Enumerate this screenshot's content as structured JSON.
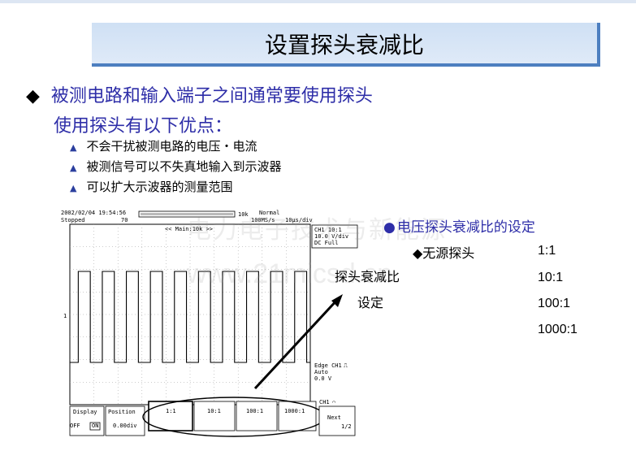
{
  "title": "设置探头衰减比",
  "bullet": {
    "line1": "被测电路和输入端子之间通常要使用探头",
    "line2": "使用探头有以下优点：",
    "subs": [
      "不会干扰被测电路的电压・电流",
      "被测信号可以不失真地输入到示波器",
      "可以扩大示波器的测量范围"
    ]
  },
  "scope": {
    "datetime": "2002/02/04 19:54:56",
    "status": "Stopped",
    "count": "70",
    "mode": "Normal",
    "rate": "100MS/s",
    "timediv": "10μs/div",
    "length": "10k",
    "main_label": "<< Main:10k >>",
    "ch_info": [
      "CH1 10:1",
      "10.0 V/div",
      "DC    Full"
    ],
    "trig_info": [
      "Edge CH1",
      "Auto",
      "0.0 V"
    ],
    "ch_marker": "1",
    "softkeys": {
      "display_label": "Display",
      "display_off": "OFF",
      "display_on": "ON",
      "position_label": "Position",
      "position_value": "0.00div",
      "r1": "1:1",
      "r10": "10:1",
      "r100": "100:1",
      "r1000": "1000:1",
      "ch_label": "CH1",
      "next_label": "Next",
      "next_page": "1/2"
    }
  },
  "right": {
    "heading": "电压探头衰减比的设定",
    "passive": "◆无源探头",
    "ratios": [
      "1:1",
      "10:1",
      "100:1",
      "1000:1"
    ]
  },
  "annotation": {
    "line1": "探头衰减比",
    "line2": "设定"
  },
  "watermark": {
    "line1": "电力电子技术与新能源",
    "line2": "www.21micsd.cn"
  }
}
